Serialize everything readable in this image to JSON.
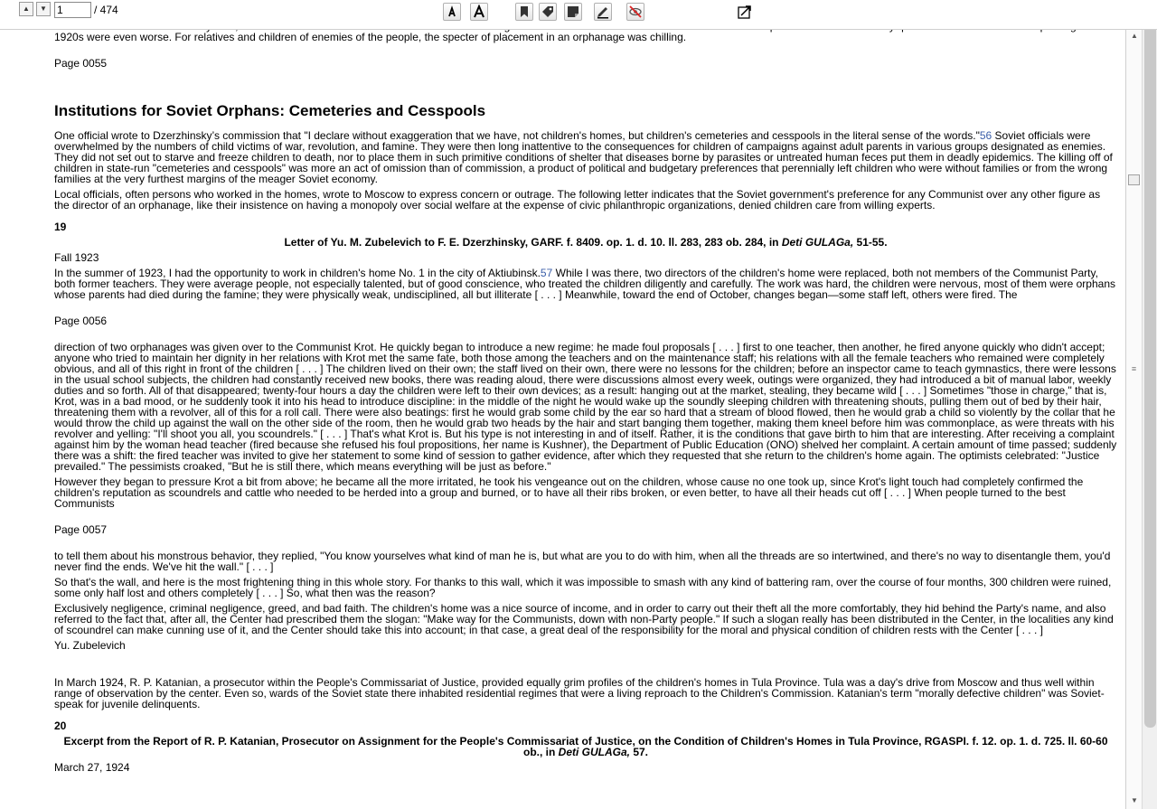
{
  "toolbar": {
    "page_value": "1",
    "page_total": "/ 474",
    "icons": [
      "page-up-icon",
      "page-down-icon",
      "font-decrease-icon",
      "font-increase-icon",
      "bookmark-icon",
      "tag-icon",
      "note-icon",
      "highlight-pen-icon",
      "hide-annotations-icon",
      "expand-icon"
    ]
  },
  "doc": {
    "top_text": "the mitochondria of the Soviet system, situated as she and her child were within a literal and figurative cell at its foundation. Conditions for children separated from their “enemy” parents and sent to Soviet orphanages in the 1920s were even worse. For relatives and children of enemies of the people, the specter of placement in an orphanage was chilling.",
    "page_55": "Page 0055",
    "section_title": "Institutions for Soviet Orphans: Cemeteries and Cesspools",
    "para1_a": "One official wrote to Dzerzhinsky’s commission that \"I declare without exaggeration that we have, not children's homes, but children's cemeteries and cesspools in the literal sense of the words.\"",
    "para1_ref": "56",
    "para1_b": " Soviet officials were overwhelmed by the numbers of child victims of war, revolution, and famine. They were then long inattentive to the consequences for children of campaigns against adult parents in various groups designated as enemies. They did not set out to starve and freeze children to death, nor to place them in such primitive conditions of shelter that diseases borne by parasites or untreated human feces put them in deadly epidemics. The killing off of children in state-run \"cemeteries and cesspools\" was more an act of omission than of commission, a product of political and budgetary preferences that perennially left children who were without families or from the wrong families at the very furthest margins of the meager Soviet economy.",
    "para2": "Local officials, often persons who worked in the homes, wrote to Moscow to express concern or outrage. The following letter indicates that the Soviet government's preference for any Communist over any other figure as the director of an orphanage, like their insistence on having a monopoly over social welfare at the expense of civic philanthropic organizations, denied children care from willing experts.",
    "doc19": "19",
    "doc19_title_a": "Letter of Yu. M. Zubelevich to F. E. Dzerzhinsky, GARF. f. 8409. op. 1. d. 10. ll. 283, 283 ob. 284, in ",
    "doc19_title_i": "Deti GULAGa,",
    "doc19_title_b": " 51-55.",
    "doc19_date": "Fall 1923",
    "letter1_a": "In the summer of 1923, I had the opportunity to work in children's home No. 1 in the city of Aktiubinsk.",
    "letter1_ref": "57",
    "letter1_b": " While I was there, two directors of the children's home were replaced, both not members of the Communist Party, both former teachers. They were average people, not especially talented, but of good conscience, who treated the children diligently and carefully. The work was hard, the children were nervous, most of them were orphans whose parents had died during the famine; they were physically weak, undisciplined, all but illiterate [ . . . ] Meanwhile, toward the end of October, changes began—some staff left, others were fired. The",
    "page_56": "Page 0056",
    "letter2": "direction of two orphanages was given over to the Communist Krot. He quickly began to introduce a new regime: he made foul proposals [ . . . ] first to one teacher, then another, he fired anyone quickly who didn't accept; anyone who tried to maintain her dignity in her relations with Krot met the same fate, both those among the teachers and on the maintenance staff; his relations with all the female teachers who remained were completely obvious, and all of this right in front of the children [ . . . ] The children lived on their own; the staff lived on their own, there were no lessons for the children; before an inspector came to teach gymnastics, there were lessons in the usual school subjects, the children had constantly received new books, there was reading aloud, there were discussions almost every week, outings were organized, they had introduced a bit of manual labor, weekly duties and so forth. All of that disappeared; twenty-four hours a day the children were left to their own devices; as a result: hanging out at the market, stealing, they became wild [ . . . ] Sometimes \"those in charge,\" that is, Krot, was in a bad mood, or he suddenly took it into his head to introduce discipline: in the middle of the night he would wake up the soundly sleeping children with threatening shouts, pulling them out of bed by their hair, threatening them with a revolver, all of this for a roll call. There were also beatings: first he would grab some child by the ear so hard that a stream of blood flowed, then he would grab a child so violently by the collar that he would throw the child up against the wall on the other side of the room, then he would grab two heads by the hair and start banging them together, making them kneel before him was commonplace, as were threats with his revolver and yelling: \"I'll shoot you all, you scoundrels.\" [ . . . ] That's what Krot is. But his type is not interesting in and of itself. Rather, it is the conditions that gave birth to him that are interesting. After receiving a complaint against him by the woman head teacher (fired because she refused his foul propositions, her name is Kushner), the Department of Public Education (ONO) shelved her complaint. A certain amount of time passed; suddenly there was a shift: the fired teacher was invited to give her statement to some kind of session to gather evidence, after which they requested that she return to the children's home again. The optimists celebrated: \"Justice prevailed.\" The pessimists croaked, \"But he is still there, which means everything will be just as before.\"",
    "letter3": "However they began to pressure Krot a bit from above; he became all the more irritated, he took his vengeance out on the children, whose cause no one took up, since Krot's light touch had completely confirmed the children's reputation as scoundrels and cattle who needed to be herded into a group and burned, or to have all their ribs broken, or even better, to have all their heads cut off [ . . . ] When people turned to the best Communists",
    "page_57": "Page 0057",
    "letter4": "to tell them about his monstrous behavior, they replied, \"You know yourselves what kind of man he is, but what are you to do with him, when all the threads are so intertwined, and there's no way to disentangle them, you'd never find the ends. We've hit the wall.\" [ . . . ]",
    "letter5": "So that's the wall, and here is the most frightening thing in this whole story. For thanks to this wall, which it was impossible to smash with any kind of battering ram, over the course of four months, 300 children were ruined, some only half lost and others completely [ . . . ] So, what then was the reason?",
    "letter6": "Exclusively negligence, criminal negligence, greed, and bad faith. The children's home was a nice source of income, and in order to carry out their theft all the more comfortably, they hid behind the Party's name, and also referred to the fact that, after all, the Center had prescribed them the slogan: \"Make way for the Communists, down with non-Party people.\" If such a slogan really has been distributed in the Center, in the localities any kind of scoundrel can make cunning use of it, and the Center should take this into account; in that case, a great deal of the responsibility for the moral and physical condition of children rests with the Center [ . . . ]",
    "signature": "Yu. Zubelevich",
    "para3": "In March 1924, R. P. Katanian, a prosecutor within the People's Commissariat of Justice, provided equally grim profiles of the children's homes in Tula Province. Tula was a day's drive from Moscow and thus well within range of observation by the center. Even so, wards of the Soviet state there inhabited residential regimes that were a living reproach to the Children's Commission. Katanian's term \"morally defective children\" was Soviet-speak for juvenile delinquents.",
    "doc20": "20",
    "doc20_title_a": "Excerpt from the Report of R. P. Katanian, Prosecutor on Assignment for the People's Commissariat of Justice, on the Condition of Children's Homes in Tula Province, RGASPI. f. 12. op. 1. d. 725. ll. 60-60 ob., in ",
    "doc20_title_i": "Deti GULAGa,",
    "doc20_title_b": " 57.",
    "doc20_date": "March 27, 1924"
  }
}
